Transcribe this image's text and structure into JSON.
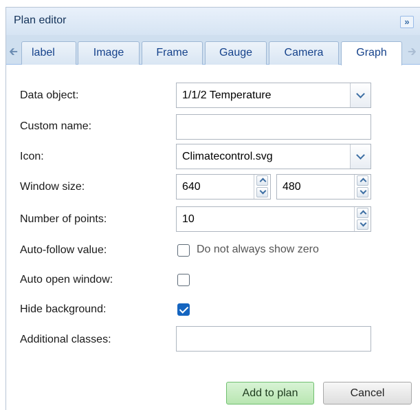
{
  "window": {
    "title": "Plan editor",
    "collapse_glyph": "»"
  },
  "tabs": {
    "scroll_left_icon": "arrow-left-icon",
    "scroll_right_icon": "arrow-right-icon",
    "items": [
      {
        "label": "label"
      },
      {
        "label": "Image"
      },
      {
        "label": "Frame"
      },
      {
        "label": "Gauge"
      },
      {
        "label": "Camera"
      },
      {
        "label": "Graph",
        "active": true
      }
    ]
  },
  "form": {
    "data_object": {
      "label": "Data object:",
      "value": "1/1/2 Temperature"
    },
    "custom_name": {
      "label": "Custom name:",
      "value": ""
    },
    "icon": {
      "label": "Icon:",
      "value": "Climatecontrol.svg"
    },
    "window_size": {
      "label": "Window size:",
      "width": "640",
      "height": "480"
    },
    "number_of_points": {
      "label": "Number of points:",
      "value": "10"
    },
    "auto_follow": {
      "label": "Auto-follow value:",
      "checkbox_label": "Do not always show zero",
      "checked": false
    },
    "auto_open": {
      "label": "Auto open window:",
      "checked": false
    },
    "hide_background": {
      "label": "Hide background:",
      "checked": true
    },
    "additional_classes": {
      "label": "Additional classes:",
      "value": ""
    }
  },
  "buttons": {
    "add": "Add to plan",
    "cancel": "Cancel"
  },
  "colors": {
    "accent": "#1565c0",
    "add_button": "#b8e6b1",
    "tab_strip": "#cfdfef"
  }
}
